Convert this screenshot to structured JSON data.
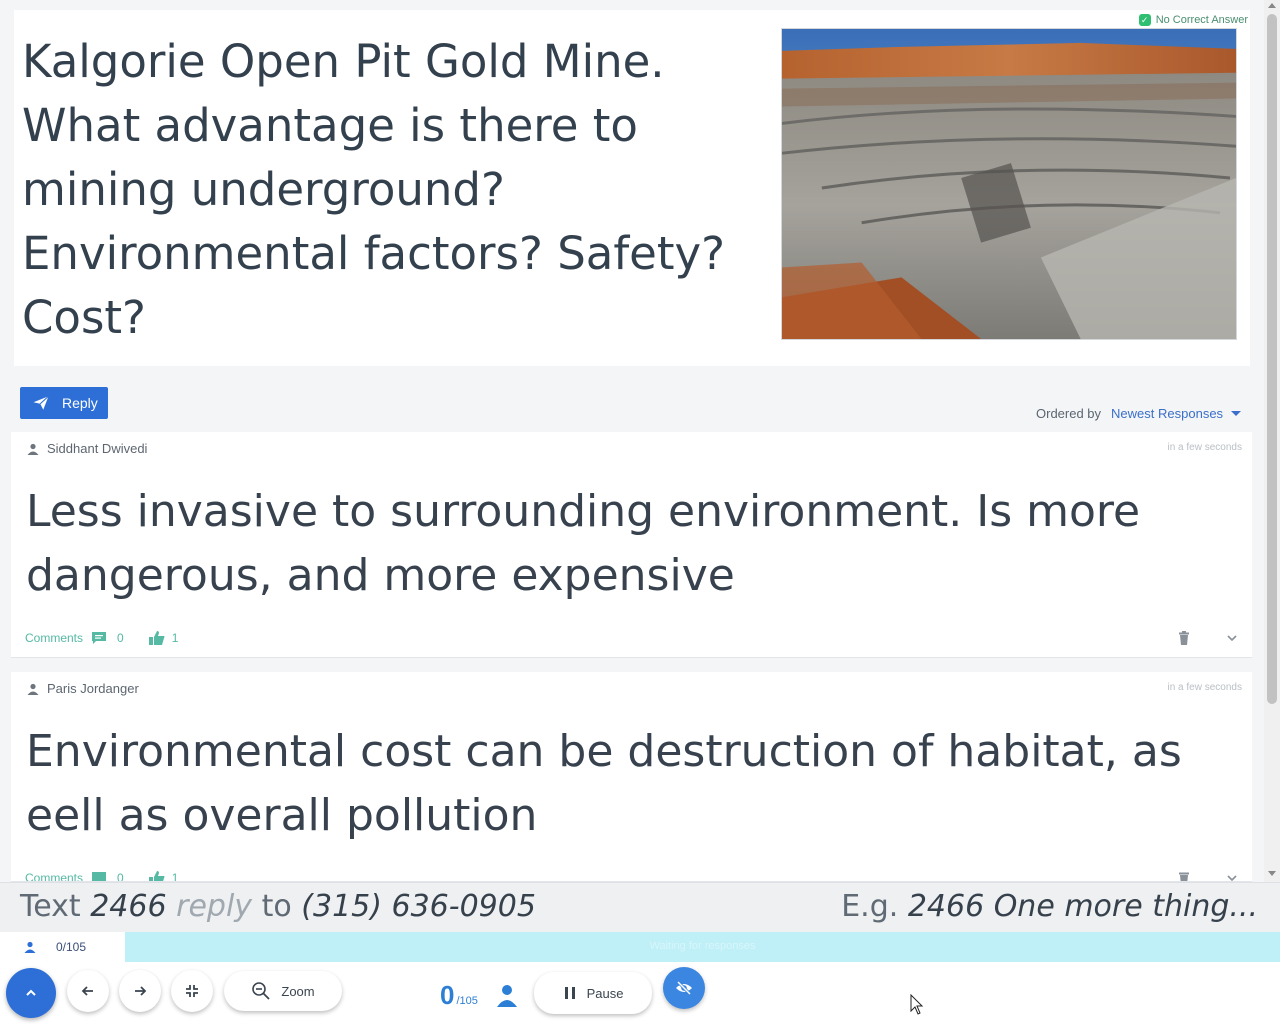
{
  "question": {
    "text": "Kalgorie Open Pit Gold Mine.  What advantage is there to mining underground?  Environmental factors? Safety? Cost?",
    "badge": "No Correct Answer",
    "image_alt": "open-pit-mine-photo"
  },
  "toolbar_top": {
    "reply_label": "Reply",
    "ordered_by_label": "Ordered by",
    "ordered_by_value": "Newest Responses"
  },
  "responses": [
    {
      "author": "Siddhant Dwivedi",
      "time": "in a few seconds",
      "text": "Less invasive to surrounding environment. Is more dangerous, and more expensive",
      "comments_label": "Comments",
      "comments_count": "0",
      "likes_count": "1"
    },
    {
      "author": "Paris Jordanger",
      "time": "in a few seconds",
      "text": "Environmental cost can be destruction of habitat, as eell as overall pollution",
      "comments_label": "Comments",
      "comments_count": "0",
      "likes_count": "1"
    }
  ],
  "instructions": {
    "left_prefix": "Text ",
    "code": "2466",
    "reply_word": "reply",
    "to_word": "to",
    "phone": "(315) 636-0905",
    "example_prefix": "E.g. ",
    "example_text": "2466 One more thing..."
  },
  "progress": {
    "response_count": "0/105",
    "bar_label": "Waiting for responses",
    "fraction": 0
  },
  "bottom_toolbar": {
    "zoom_label": "Zoom",
    "counter_value": "0",
    "counter_total": "/105",
    "pause_label": "Pause"
  },
  "colors": {
    "accent": "#2d6fd6",
    "teal": "#55b9a3",
    "progress_bar": "#bfeff7"
  }
}
